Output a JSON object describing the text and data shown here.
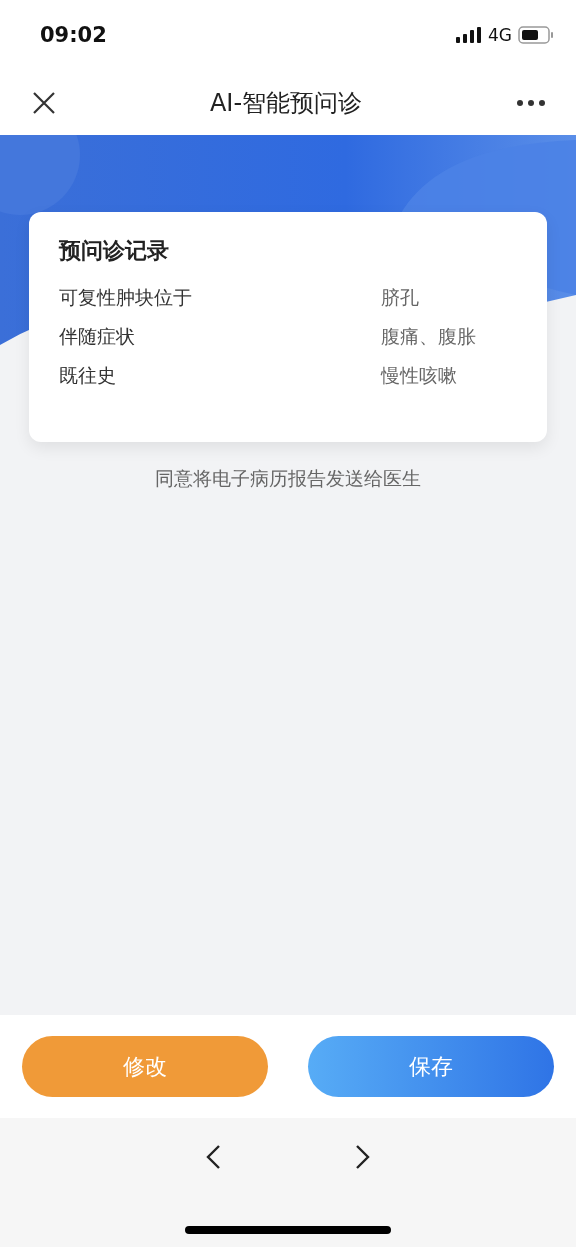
{
  "status_bar": {
    "time": "09:02",
    "network": "4G"
  },
  "nav_bar": {
    "title": "AI-智能预问诊"
  },
  "record_card": {
    "title": "预问诊记录",
    "rows": [
      {
        "label": "可复性肿块位于",
        "value": "脐孔"
      },
      {
        "label": "伴随症状",
        "value": "腹痛、腹胀"
      },
      {
        "label": "既往史",
        "value": "慢性咳嗽"
      }
    ]
  },
  "consent_text": "同意将电子病历报告发送给医生",
  "buttons": [
    {
      "label": "修改",
      "kind": "secondary"
    },
    {
      "label": "保存",
      "kind": "primary"
    }
  ]
}
